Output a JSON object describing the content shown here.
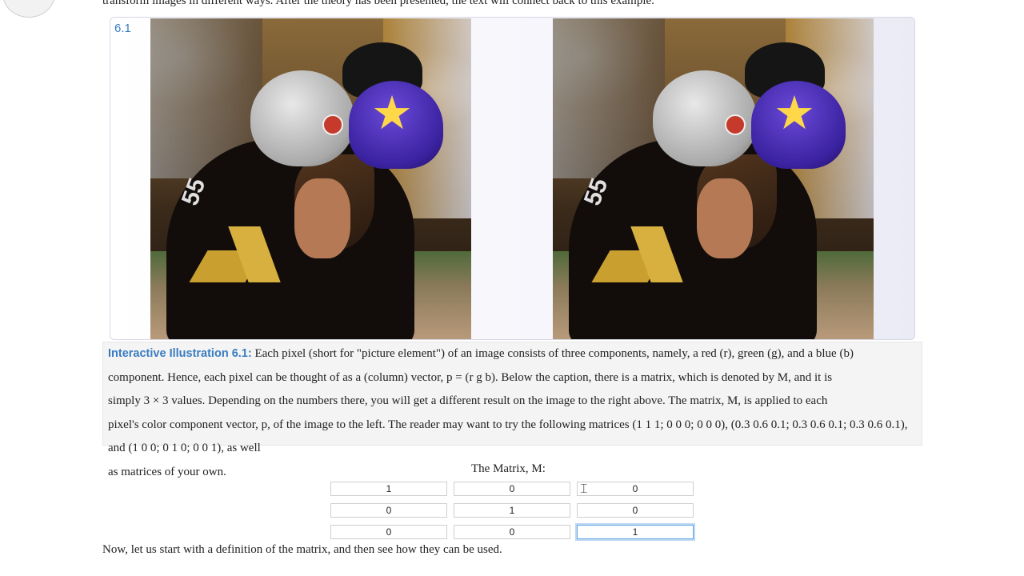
{
  "intro": {
    "text": "transform images in different ways. After the theory has been presented, the text will connect back to this example."
  },
  "figure": {
    "number": "6.1",
    "left_image": "roller-derby-photo-original",
    "right_image": "roller-derby-photo-transformed",
    "label_color": "#3a7cc0"
  },
  "caption": {
    "label": "Interactive Illustration 6.1:",
    "line1": "Each pixel (short for \"picture element\") of an image consists of three components, namely, a red (r), green (g), and a blue (b)",
    "line2": "component. Hence, each pixel can be thought of as a (column) vector, p = (r g b). Below the caption, there is a matrix, which is denoted by M, and it is",
    "line3": "simply 3 × 3 values. Depending on the numbers there, you will get a different result on the image to the right above. The matrix, M, is applied to each",
    "line4": "pixel's color component vector, p, of the image to the left. The reader may want to try the following matrices (1 1 1; 0 0 0; 0 0 0), (0.3 0.6 0.1; 0.3 0.6 0.1; 0.3 0.6 0.1), and (1 0 0; 0 1 0; 0 0 1), as well",
    "line5": "as matrices of your own."
  },
  "matrix": {
    "title": "The Matrix, M:",
    "rows": [
      [
        "1",
        "0",
        "0"
      ],
      [
        "0",
        "1",
        "0"
      ],
      [
        "0",
        "0",
        "1"
      ]
    ]
  },
  "closing": {
    "text": "Now, let us start with a definition of the matrix, and then see how they can be used."
  }
}
